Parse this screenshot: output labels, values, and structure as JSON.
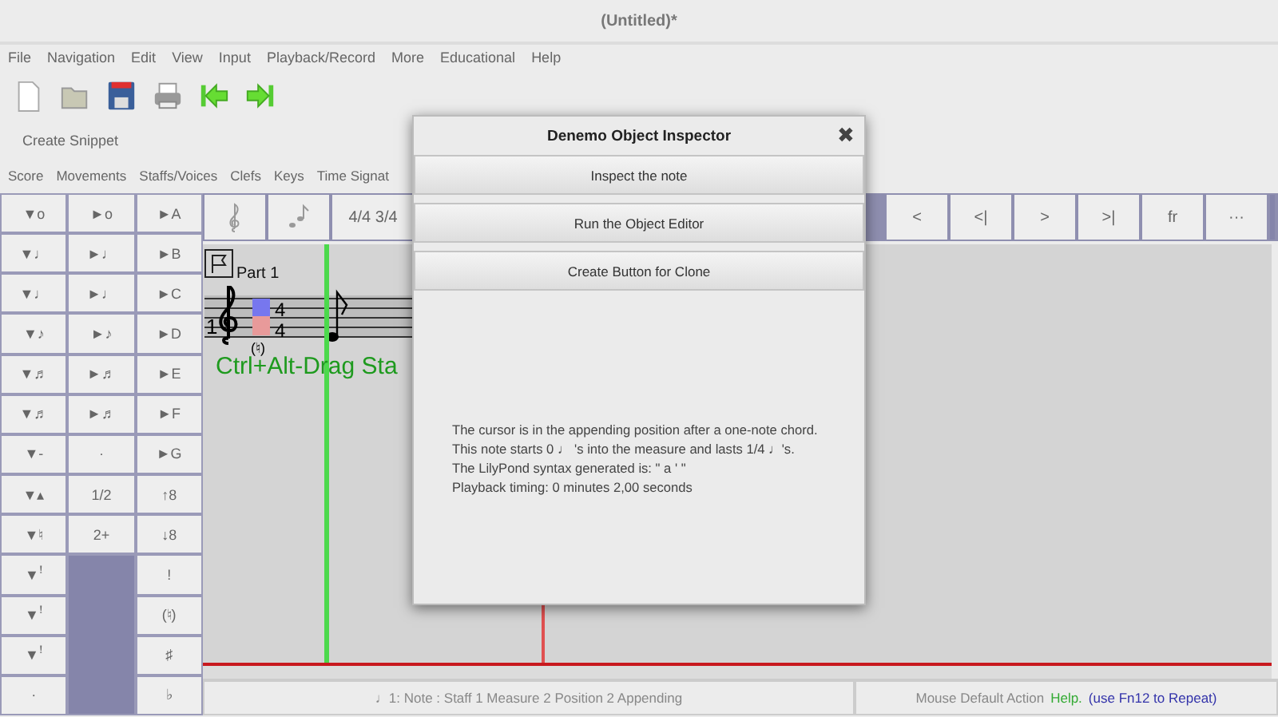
{
  "window": {
    "title": "(Untitled)*"
  },
  "menu": [
    "File",
    "Navigation",
    "Edit",
    "View",
    "Input",
    "Playback/Record",
    "More",
    "Educational",
    "Help"
  ],
  "toolbar": [
    {
      "kind": "new"
    },
    {
      "kind": "open"
    },
    {
      "kind": "save"
    },
    {
      "kind": "print"
    },
    {
      "kind": "back"
    },
    {
      "kind": "forward"
    }
  ],
  "snippet_bar": {
    "label": "Create Snippet"
  },
  "palette_tabs": [
    "Score",
    "Movements",
    "Staffs/Voices",
    "Clefs",
    "Keys",
    "Time Signat"
  ],
  "palette": {
    "columns": [
      [
        "▼o",
        "▼♩",
        "▼♩",
        "▼♪",
        "▼♬",
        "▼♬",
        "▼-",
        "▼▴",
        "▼♮",
        "▼ꜝ",
        "▼ꜝ",
        "▼ꜝ",
        "·"
      ],
      [
        "►o",
        "►♩",
        "►♩",
        "►♪",
        "►♬",
        "►♬",
        "·",
        "1/2",
        "2+"
      ],
      [
        "►A",
        "►B",
        "►C",
        "►D",
        "►E",
        "►F",
        "►G",
        "↑8",
        "↓8",
        "!",
        "(♮)",
        "♯",
        "♭"
      ]
    ]
  },
  "score_buttons": {
    "left": [
      {
        "kind": "clef"
      },
      {
        "kind": "notes"
      },
      {
        "kind": "text",
        "label": "4/4 3/4"
      }
    ],
    "right": [
      "<",
      "<|",
      ">",
      ">|",
      "fr",
      "···"
    ]
  },
  "score": {
    "part": "Part 1",
    "staff_number": "1",
    "time_signature": [
      "4",
      "4"
    ],
    "accidental": "(♮)",
    "hint": "Ctrl+Alt-Drag Sta"
  },
  "status": {
    "position": "♩1: Note :  Staff 1 Measure 2 Position 2 Appending",
    "action": "Mouse Default Action",
    "help": "Help.",
    "repeat": "(use Fn12 to Repeat)"
  },
  "inspector": {
    "title": "Denemo Object Inspector",
    "close": "✖",
    "buttons": [
      "Inspect the note",
      "Run the Object Editor",
      "Create Button for Clone"
    ],
    "lines": [
      "The cursor is in the appending position after a one-note chord.",
      "This note starts 0 ♩ 's into the measure and lasts 1/4 ♩'s.",
      "The LilyPond syntax generated is: \"  a  '  \"",
      "Playback timing: 0 minutes 2,00 seconds"
    ]
  }
}
